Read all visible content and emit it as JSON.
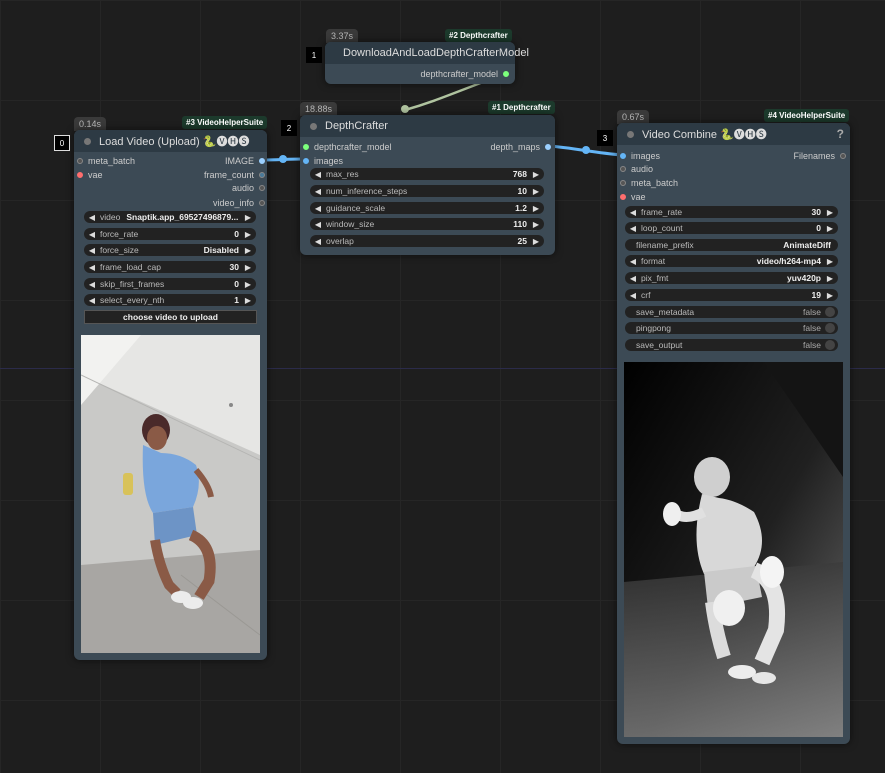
{
  "nodes": {
    "depth_model": {
      "id": "1",
      "time": "3.37s",
      "pack": "#2 Depthcrafter",
      "title": "DownloadAndLoadDepthCrafterModel",
      "output": "depthcrafter_model"
    },
    "depthcrafter": {
      "id": "2",
      "time": "18.88s",
      "pack": "#1 Depthcrafter",
      "title": "DepthCrafter",
      "inputs": [
        "depthcrafter_model",
        "images"
      ],
      "output": "depth_maps",
      "widgets": [
        {
          "label": "max_res",
          "value": "768"
        },
        {
          "label": "num_inference_steps",
          "value": "10"
        },
        {
          "label": "guidance_scale",
          "value": "1.2"
        },
        {
          "label": "window_size",
          "value": "110"
        },
        {
          "label": "overlap",
          "value": "25"
        }
      ]
    },
    "load_video": {
      "id": "0",
      "time": "0.14s",
      "pack": "#3 VideoHelperSuite",
      "title": "Load Video (Upload) 🐍🅥🅗🅢",
      "inputs": [
        "meta_batch",
        "vae"
      ],
      "outputs": [
        "IMAGE",
        "frame_count",
        "audio",
        "video_info"
      ],
      "widgets": [
        {
          "label": "video",
          "value": "Snaptik.app_69527496879..."
        },
        {
          "label": "force_rate",
          "value": "0"
        },
        {
          "label": "force_size",
          "value": "Disabled"
        },
        {
          "label": "frame_load_cap",
          "value": "30"
        },
        {
          "label": "skip_first_frames",
          "value": "0"
        },
        {
          "label": "select_every_nth",
          "value": "1"
        }
      ],
      "button": "choose video to upload"
    },
    "video_combine": {
      "id": "3",
      "time": "0.67s",
      "pack": "#4 VideoHelperSuite",
      "title": "Video Combine 🐍🅥🅗🅢",
      "help": "?",
      "inputs": [
        "images",
        "audio",
        "meta_batch",
        "vae"
      ],
      "output": "Filenames",
      "widgets": [
        {
          "label": "frame_rate",
          "value": "30",
          "kind": "num"
        },
        {
          "label": "loop_count",
          "value": "0",
          "kind": "num"
        },
        {
          "label": "filename_prefix",
          "value": "AnimateDiff",
          "kind": "text"
        },
        {
          "label": "format",
          "value": "video/h264-mp4",
          "kind": "num"
        },
        {
          "label": "pix_fmt",
          "value": "yuv420p",
          "kind": "num"
        },
        {
          "label": "crf",
          "value": "19",
          "kind": "num"
        },
        {
          "label": "save_metadata",
          "value": "false",
          "kind": "toggle"
        },
        {
          "label": "pingpong",
          "value": "false",
          "kind": "toggle"
        },
        {
          "label": "save_output",
          "value": "false",
          "kind": "toggle"
        }
      ]
    }
  },
  "colors": {
    "image_link": "#64b5f6",
    "model_link": "#b0c4a0",
    "vae_socket": "#ff6e6e",
    "model_socket": "#7cff7c"
  }
}
